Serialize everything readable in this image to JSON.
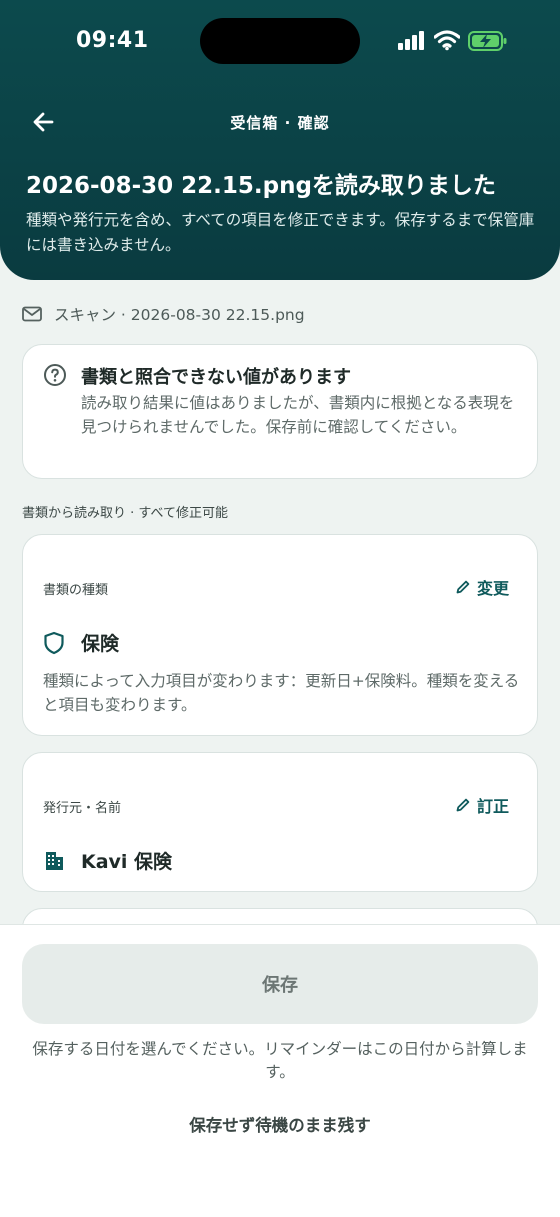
{
  "status": {
    "time": "09:41"
  },
  "nav": {
    "title": "受信箱 · 確認"
  },
  "header": {
    "title": "2026-08-30 22.15.pngを読み取りました",
    "subtitle": "種類や発行元を含め、すべての項目を修正できます。保存するまで保管庫には書き込みません。"
  },
  "source": {
    "text": "スキャン · 2026-08-30 22.15.png"
  },
  "warning": {
    "title": "書類と照合できない値があります",
    "body": "読み取り結果に値はありましたが、書類内に根拠となる表現を見つけられませんでした。保存前に確認してください。"
  },
  "section": {
    "label": "書類から読み取り · すべて修正可能"
  },
  "fields": [
    {
      "label": "書類の種類",
      "action": "変更",
      "value": "保険",
      "help": "種類によって入力項目が変わります：更新日+保険料。種類を変えると項目も変わります。"
    },
    {
      "label": "発行元・名前",
      "action": "訂正",
      "value": "Kavi 保険"
    }
  ],
  "footer": {
    "save_label": "保存",
    "save_note": "保存する日付を選んでください。リマインダーはこの日付から計算します。",
    "leave_label": "保存せず待機のまま残す"
  },
  "colors": {
    "header": "#0c4a4d",
    "accent": "#0f5a5c",
    "battery": "#5fd06a"
  }
}
